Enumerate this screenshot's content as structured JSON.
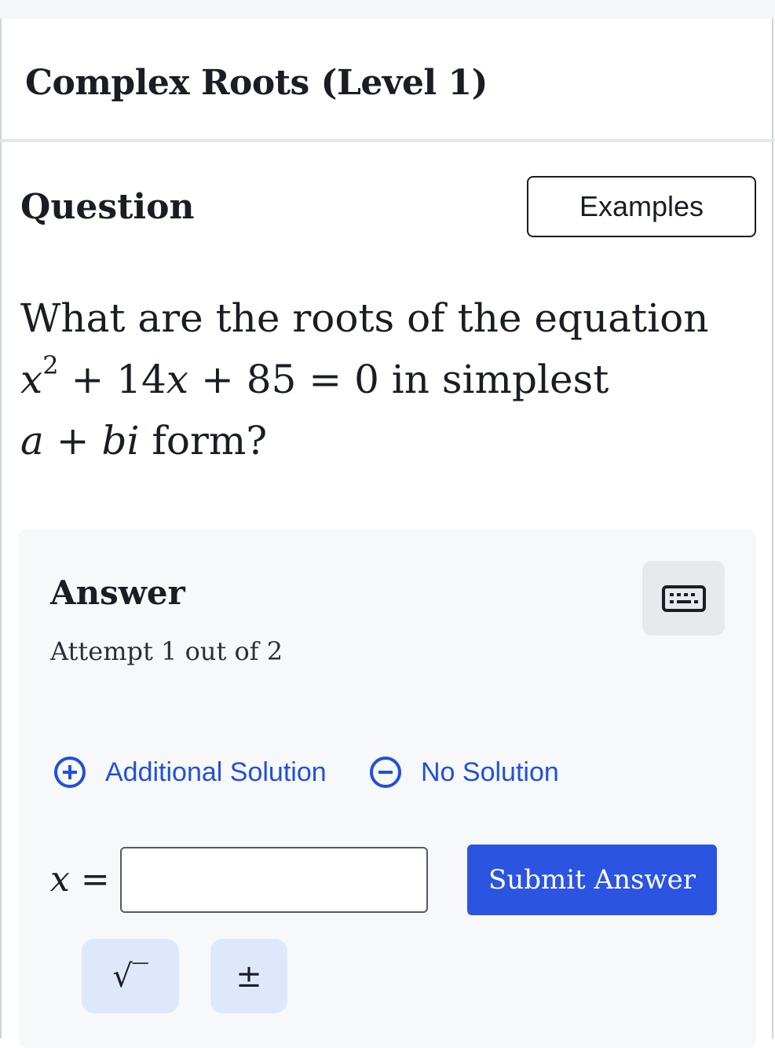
{
  "page": {
    "title": "Complex Roots (Level 1)"
  },
  "question_section": {
    "heading": "Question",
    "examples_button": "Examples",
    "text_before": "What are the roots of the equation",
    "equation": {
      "var": "x",
      "exponent": "2",
      "rest": " + 14",
      "var2": "x",
      "tail": " + 85 = 0"
    },
    "text_middle": "in simplest",
    "form": {
      "a": "a",
      "plus": " + ",
      "b": "b",
      "i": "i"
    },
    "text_after": "form?"
  },
  "answer_section": {
    "heading": "Answer",
    "attempt_text": "Attempt 1 out of 2",
    "options": {
      "additional_solution": "Additional Solution",
      "no_solution": "No Solution"
    },
    "input_label_var": "x",
    "input_label_eq": " =",
    "input_value": "",
    "submit_button": "Submit Answer",
    "symbol_buttons": {
      "sqrt": "√‾",
      "plus_minus": "±"
    },
    "icons": {
      "keyboard": "keyboard-icon",
      "add": "plus-circle-icon",
      "remove": "minus-circle-icon"
    }
  },
  "colors": {
    "accent": "#2b54e0",
    "link": "#2250d9",
    "panel": "#f7f8fa",
    "symbol_button": "#dfe8fb"
  }
}
